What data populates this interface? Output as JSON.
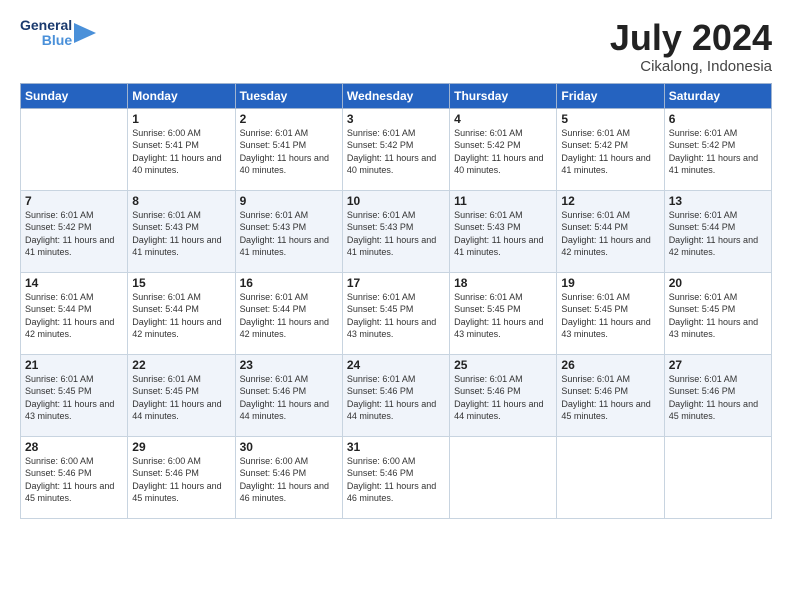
{
  "logo": {
    "line1": "General",
    "line2": "Blue"
  },
  "title": "July 2024",
  "location": "Cikalong, Indonesia",
  "header_days": [
    "Sunday",
    "Monday",
    "Tuesday",
    "Wednesday",
    "Thursday",
    "Friday",
    "Saturday"
  ],
  "weeks": [
    [
      {
        "num": "",
        "sunrise": "",
        "sunset": "",
        "daylight": ""
      },
      {
        "num": "1",
        "sunrise": "6:00 AM",
        "sunset": "5:41 PM",
        "daylight": "11 hours and 40 minutes."
      },
      {
        "num": "2",
        "sunrise": "6:01 AM",
        "sunset": "5:41 PM",
        "daylight": "11 hours and 40 minutes."
      },
      {
        "num": "3",
        "sunrise": "6:01 AM",
        "sunset": "5:42 PM",
        "daylight": "11 hours and 40 minutes."
      },
      {
        "num": "4",
        "sunrise": "6:01 AM",
        "sunset": "5:42 PM",
        "daylight": "11 hours and 40 minutes."
      },
      {
        "num": "5",
        "sunrise": "6:01 AM",
        "sunset": "5:42 PM",
        "daylight": "11 hours and 41 minutes."
      },
      {
        "num": "6",
        "sunrise": "6:01 AM",
        "sunset": "5:42 PM",
        "daylight": "11 hours and 41 minutes."
      }
    ],
    [
      {
        "num": "7",
        "sunrise": "6:01 AM",
        "sunset": "5:42 PM",
        "daylight": "11 hours and 41 minutes."
      },
      {
        "num": "8",
        "sunrise": "6:01 AM",
        "sunset": "5:43 PM",
        "daylight": "11 hours and 41 minutes."
      },
      {
        "num": "9",
        "sunrise": "6:01 AM",
        "sunset": "5:43 PM",
        "daylight": "11 hours and 41 minutes."
      },
      {
        "num": "10",
        "sunrise": "6:01 AM",
        "sunset": "5:43 PM",
        "daylight": "11 hours and 41 minutes."
      },
      {
        "num": "11",
        "sunrise": "6:01 AM",
        "sunset": "5:43 PM",
        "daylight": "11 hours and 41 minutes."
      },
      {
        "num": "12",
        "sunrise": "6:01 AM",
        "sunset": "5:44 PM",
        "daylight": "11 hours and 42 minutes."
      },
      {
        "num": "13",
        "sunrise": "6:01 AM",
        "sunset": "5:44 PM",
        "daylight": "11 hours and 42 minutes."
      }
    ],
    [
      {
        "num": "14",
        "sunrise": "6:01 AM",
        "sunset": "5:44 PM",
        "daylight": "11 hours and 42 minutes."
      },
      {
        "num": "15",
        "sunrise": "6:01 AM",
        "sunset": "5:44 PM",
        "daylight": "11 hours and 42 minutes."
      },
      {
        "num": "16",
        "sunrise": "6:01 AM",
        "sunset": "5:44 PM",
        "daylight": "11 hours and 42 minutes."
      },
      {
        "num": "17",
        "sunrise": "6:01 AM",
        "sunset": "5:45 PM",
        "daylight": "11 hours and 43 minutes."
      },
      {
        "num": "18",
        "sunrise": "6:01 AM",
        "sunset": "5:45 PM",
        "daylight": "11 hours and 43 minutes."
      },
      {
        "num": "19",
        "sunrise": "6:01 AM",
        "sunset": "5:45 PM",
        "daylight": "11 hours and 43 minutes."
      },
      {
        "num": "20",
        "sunrise": "6:01 AM",
        "sunset": "5:45 PM",
        "daylight": "11 hours and 43 minutes."
      }
    ],
    [
      {
        "num": "21",
        "sunrise": "6:01 AM",
        "sunset": "5:45 PM",
        "daylight": "11 hours and 43 minutes."
      },
      {
        "num": "22",
        "sunrise": "6:01 AM",
        "sunset": "5:45 PM",
        "daylight": "11 hours and 44 minutes."
      },
      {
        "num": "23",
        "sunrise": "6:01 AM",
        "sunset": "5:46 PM",
        "daylight": "11 hours and 44 minutes."
      },
      {
        "num": "24",
        "sunrise": "6:01 AM",
        "sunset": "5:46 PM",
        "daylight": "11 hours and 44 minutes."
      },
      {
        "num": "25",
        "sunrise": "6:01 AM",
        "sunset": "5:46 PM",
        "daylight": "11 hours and 44 minutes."
      },
      {
        "num": "26",
        "sunrise": "6:01 AM",
        "sunset": "5:46 PM",
        "daylight": "11 hours and 45 minutes."
      },
      {
        "num": "27",
        "sunrise": "6:01 AM",
        "sunset": "5:46 PM",
        "daylight": "11 hours and 45 minutes."
      }
    ],
    [
      {
        "num": "28",
        "sunrise": "6:00 AM",
        "sunset": "5:46 PM",
        "daylight": "11 hours and 45 minutes."
      },
      {
        "num": "29",
        "sunrise": "6:00 AM",
        "sunset": "5:46 PM",
        "daylight": "11 hours and 45 minutes."
      },
      {
        "num": "30",
        "sunrise": "6:00 AM",
        "sunset": "5:46 PM",
        "daylight": "11 hours and 46 minutes."
      },
      {
        "num": "31",
        "sunrise": "6:00 AM",
        "sunset": "5:46 PM",
        "daylight": "11 hours and 46 minutes."
      },
      {
        "num": "",
        "sunrise": "",
        "sunset": "",
        "daylight": ""
      },
      {
        "num": "",
        "sunrise": "",
        "sunset": "",
        "daylight": ""
      },
      {
        "num": "",
        "sunrise": "",
        "sunset": "",
        "daylight": ""
      }
    ]
  ]
}
